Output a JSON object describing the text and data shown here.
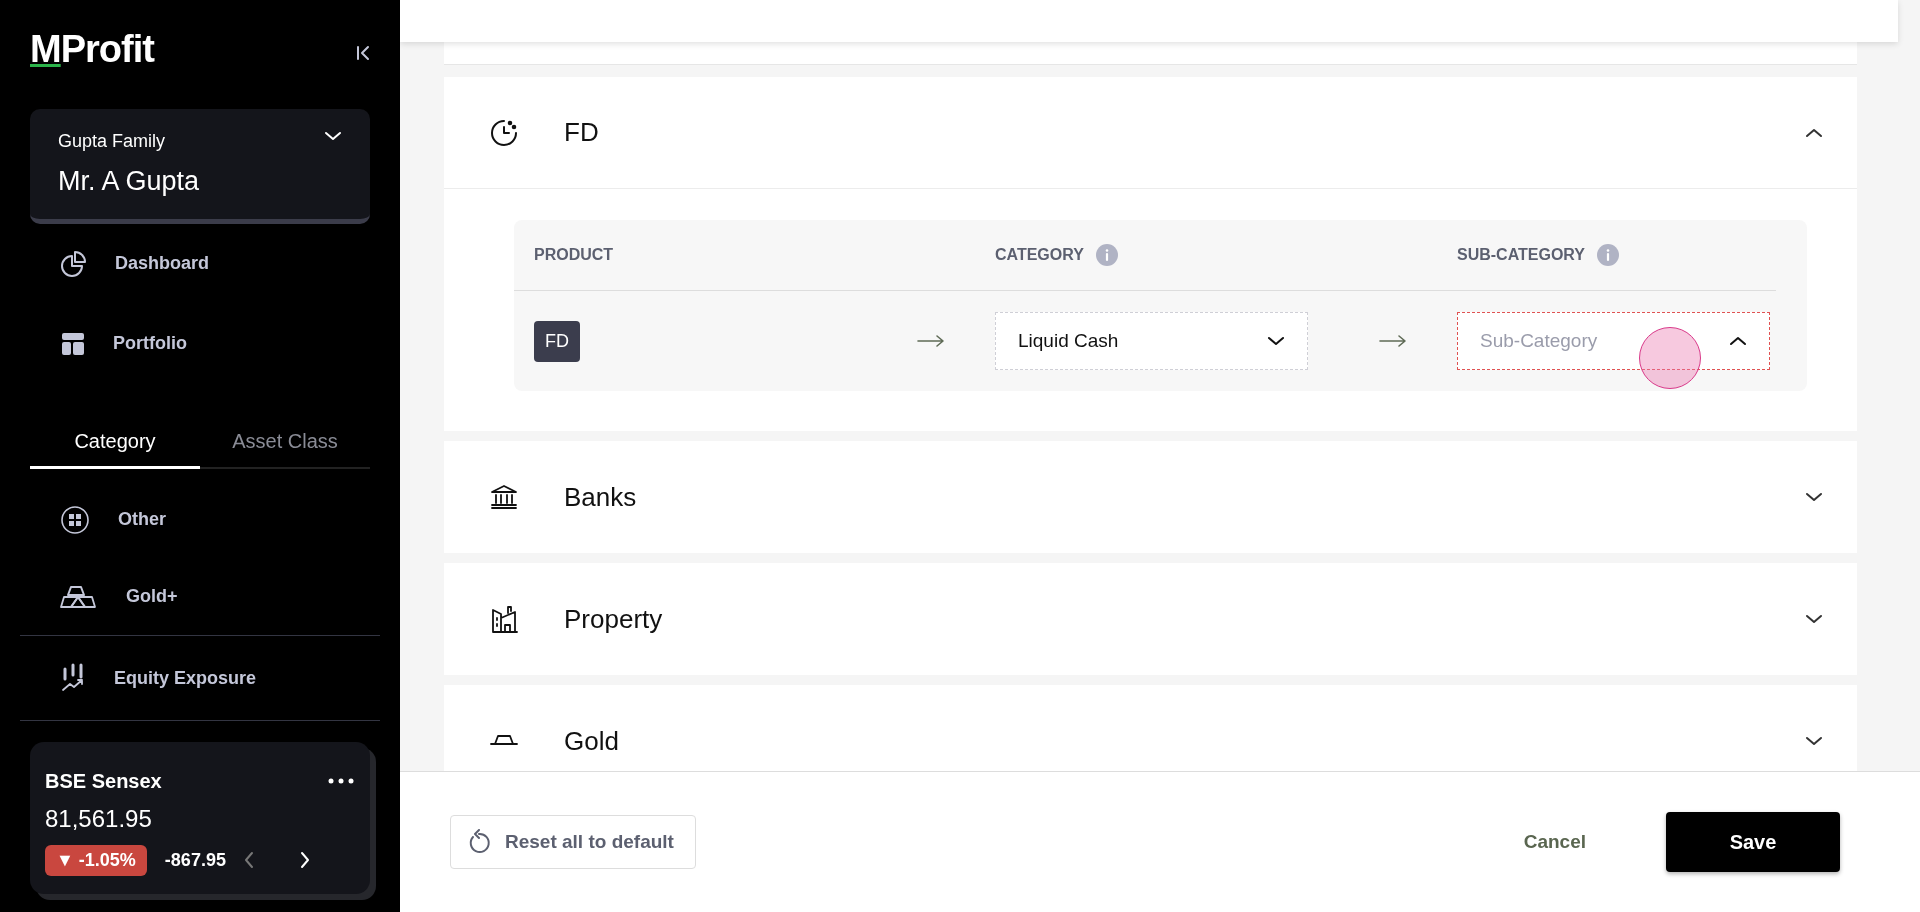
{
  "sidebar": {
    "logo": "MProfit",
    "family": {
      "group": "Gupta Family",
      "member": "Mr. A Gupta"
    },
    "nav": [
      {
        "label": "Dashboard"
      },
      {
        "label": "Portfolio"
      }
    ],
    "tabs": [
      {
        "label": "Category",
        "selected": true
      },
      {
        "label": "Asset Class",
        "selected": false
      }
    ],
    "categories": [
      {
        "label": "Other"
      },
      {
        "label": "Gold+"
      }
    ],
    "exposure": {
      "label": "Equity Exposure"
    },
    "market": {
      "name": "BSE Sensex",
      "value": "81,561.95",
      "trend_symbol": "▼",
      "change_pct": "-1.05%",
      "change": "-867.95"
    }
  },
  "sections": [
    {
      "title": "FD",
      "expanded": true,
      "table": {
        "columns": [
          {
            "label": "PRODUCT",
            "info": false
          },
          {
            "label": "CATEGORY",
            "info": true
          },
          {
            "label": "SUB-CATEGORY",
            "info": true
          }
        ],
        "rows": [
          {
            "product": "FD",
            "category": {
              "value": "Liquid Cash",
              "open": false,
              "error": false
            },
            "sub_category": {
              "placeholder": "Sub-Category",
              "open": true,
              "error": true
            }
          }
        ]
      }
    },
    {
      "title": "Banks",
      "expanded": false
    },
    {
      "title": "Property",
      "expanded": false
    },
    {
      "title": "Gold",
      "expanded": false
    }
  ],
  "footer": {
    "reset": "Reset all to default",
    "cancel": "Cancel",
    "save": "Save"
  }
}
